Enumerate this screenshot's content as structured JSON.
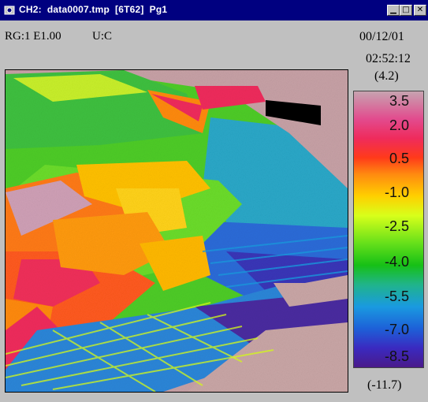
{
  "window": {
    "title": "CH2:  data0007.tmp  [6T62]  Pg1"
  },
  "status": {
    "range": "RG:1 E1.00",
    "unit": "U:C",
    "date": "00/12/01",
    "time": "02:52:12"
  },
  "readout": {
    "max": "(4.2)",
    "min": "(-11.7)"
  },
  "scale": {
    "labels": [
      "3.5",
      "2.0",
      "0.5",
      "-1.0",
      "-2.5",
      "-4.0",
      "-5.5",
      "-7.0",
      "-8.5"
    ]
  },
  "colors": {
    "titlebar": "#000080",
    "chrome": "#c0c0c0"
  },
  "icons": {
    "app": "thermal-camera-icon",
    "minimize": "minimize-icon",
    "maximize": "maximize-icon",
    "close": "close-icon"
  }
}
